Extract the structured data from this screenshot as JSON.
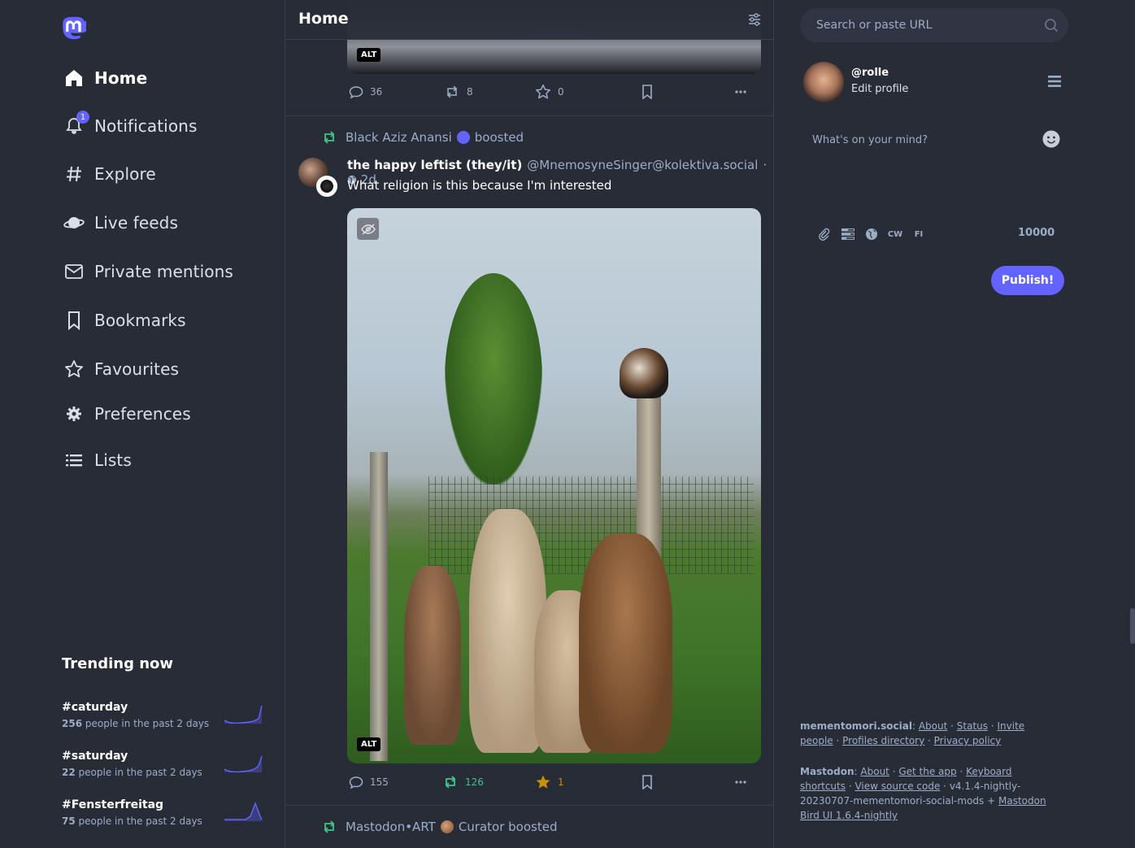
{
  "nav": {
    "items": [
      {
        "label": "Home",
        "icon": "home-icon",
        "active": true
      },
      {
        "label": "Notifications",
        "icon": "bell-icon",
        "badge": "1"
      },
      {
        "label": "Explore",
        "icon": "hashtag-icon"
      },
      {
        "label": "Live feeds",
        "icon": "globe-icon"
      },
      {
        "label": "Private mentions",
        "icon": "mail-icon"
      },
      {
        "label": "Bookmarks",
        "icon": "bookmark-icon"
      },
      {
        "label": "Favourites",
        "icon": "star-icon"
      },
      {
        "label": "Preferences",
        "icon": "gear-icon"
      },
      {
        "label": "Lists",
        "icon": "list-icon"
      }
    ]
  },
  "trending": {
    "title": "Trending now",
    "items": [
      {
        "tag": "#caturday",
        "count": "256",
        "suffix": "people in the past 2 days"
      },
      {
        "tag": "#saturday",
        "count": "22",
        "suffix": "people in the past 2 days"
      },
      {
        "tag": "#Fensterfreitag",
        "count": "75",
        "suffix": "people in the past 2 days"
      }
    ]
  },
  "column": {
    "title": "Home"
  },
  "post_prev": {
    "alt": "ALT",
    "replies": "36",
    "boosts": "8",
    "favs": "0"
  },
  "post": {
    "booster": "Black Aziz Anansi",
    "boosted_label": "boosted",
    "display_name": "the happy leftist (they/it)",
    "acct": "@MnemosyneSinger@kolektiva.social",
    "separator": "·",
    "ago": "2d",
    "text": "What religion is this because I'm interested",
    "alt": "ALT",
    "replies": "155",
    "boosts": "126",
    "favs": "1"
  },
  "post_next": {
    "booster": "Mastodon•ART",
    "boosted_label": "Curator boosted"
  },
  "right": {
    "search_placeholder": "Search or paste URL",
    "acct": "@rolle",
    "edit_profile": "Edit profile",
    "compose_placeholder": "What's on your mind?",
    "tool_cw": "CW",
    "tool_lang": "FI",
    "char_count": "10000",
    "publish": "Publish!"
  },
  "footer": {
    "server": "mementomori.social",
    "server_links": [
      "About",
      "Status",
      "Invite people",
      "Profiles directory",
      "Privacy policy"
    ],
    "mastodon": "Mastodon",
    "mastodon_links": [
      "About",
      "Get the app",
      "Keyboard shortcuts",
      "View source code"
    ],
    "version": "v4.1.4-nightly-20230707-mementomori-social-mods +",
    "birdui": "Mastodon Bird UI 1.6.4-nightly"
  },
  "colors": {
    "bg": "#282c37",
    "accent": "#6364ff",
    "boost_green": "#41c48a",
    "fav_gold": "#ca8f04",
    "muted": "#9baec8"
  }
}
